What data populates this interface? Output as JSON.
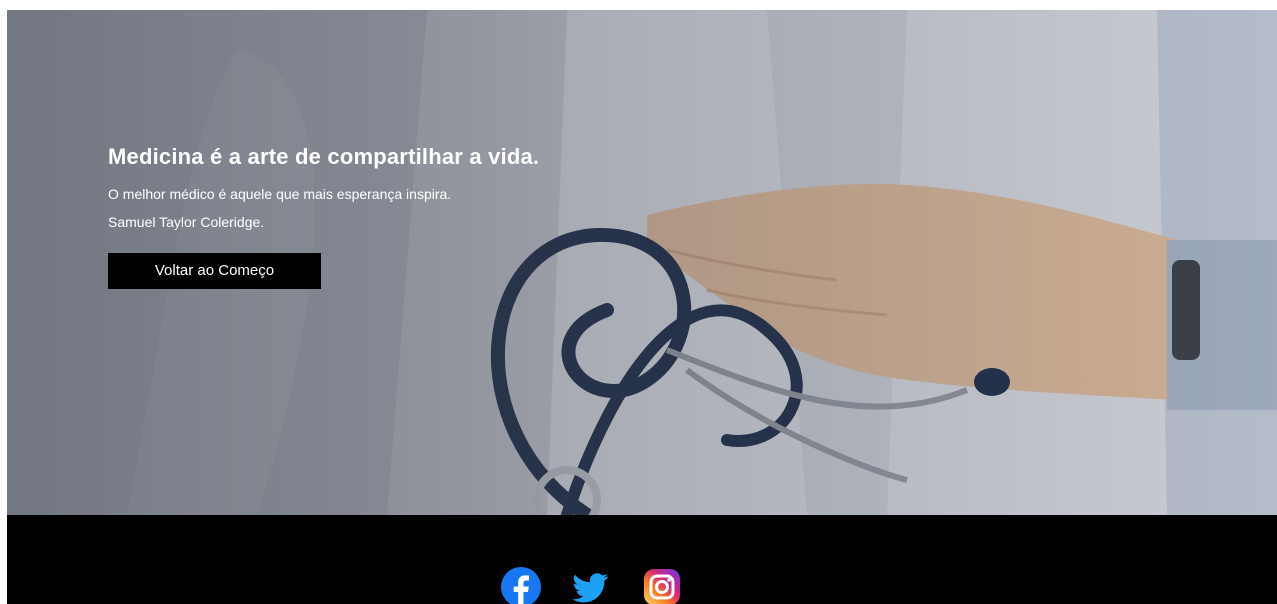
{
  "hero": {
    "title": "Medicina é a arte de compartilhar a vida.",
    "quote": "O melhor médico é aquele que mais esperança inspira.",
    "author": "Samuel Taylor Coleridge.",
    "button_label": "Voltar ao Começo"
  },
  "footer": {
    "social": [
      {
        "icon": "facebook-icon",
        "color": "#1877f2"
      },
      {
        "icon": "twitter-icon",
        "color": "#1da1f2"
      },
      {
        "icon": "instagram-icon",
        "color": "#e1306c"
      }
    ]
  },
  "colors": {
    "button_bg": "#000000",
    "footer_bg": "#000000",
    "text": "#ffffff"
  }
}
